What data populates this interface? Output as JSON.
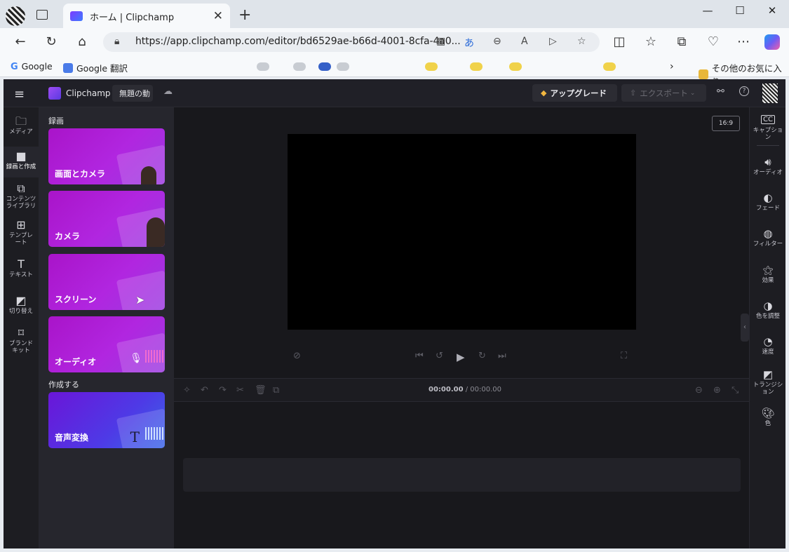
{
  "browser": {
    "tab_title": "ホーム | Clipchamp",
    "url": "https://app.clipchamp.com/editor/bd6529ae-b66d-4001-8cfa-4a0...",
    "bookmarks": [
      "Google",
      "Google 翻訳",
      "その他のお気に入り"
    ]
  },
  "app": {
    "logo": "Clipchamp",
    "project_title": "無題の動",
    "upgrade_label": "アップグレード",
    "export_label": "エクスポート",
    "aspect_ratio": "16:9",
    "time_current": "00:00.00",
    "time_total": "/ 00:00.00"
  },
  "left_nav": [
    {
      "label": "メディア",
      "icon": "folder-icon"
    },
    {
      "label": "録画と作成",
      "icon": "camera-icon"
    },
    {
      "label": "コンテンツライブラリ",
      "icon": "library-icon"
    },
    {
      "label": "テンプレート",
      "icon": "grid-icon"
    },
    {
      "label": "テキスト",
      "icon": "text-icon"
    },
    {
      "label": "切り替え",
      "icon": "transition-icon"
    },
    {
      "label": "ブランドキット",
      "icon": "brand-icon"
    }
  ],
  "panel": {
    "record_heading": "録画",
    "create_heading": "作成する",
    "cards": [
      "画面とカメラ",
      "カメラ",
      "スクリーン",
      "オーディオ",
      "音声変換"
    ]
  },
  "right_nav": [
    {
      "label": "キャプション",
      "icon": "cc-icon"
    },
    {
      "label": "オーディオ",
      "icon": "speaker-icon"
    },
    {
      "label": "フェード",
      "icon": "fade-icon"
    },
    {
      "label": "フィルター",
      "icon": "filter-icon"
    },
    {
      "label": "効果",
      "icon": "magic-wand-icon"
    },
    {
      "label": "色を調整",
      "icon": "contrast-icon"
    },
    {
      "label": "速度",
      "icon": "speed-icon"
    },
    {
      "label": "トランジション",
      "icon": "transition-icon"
    },
    {
      "label": "色",
      "icon": "palette-icon"
    }
  ]
}
